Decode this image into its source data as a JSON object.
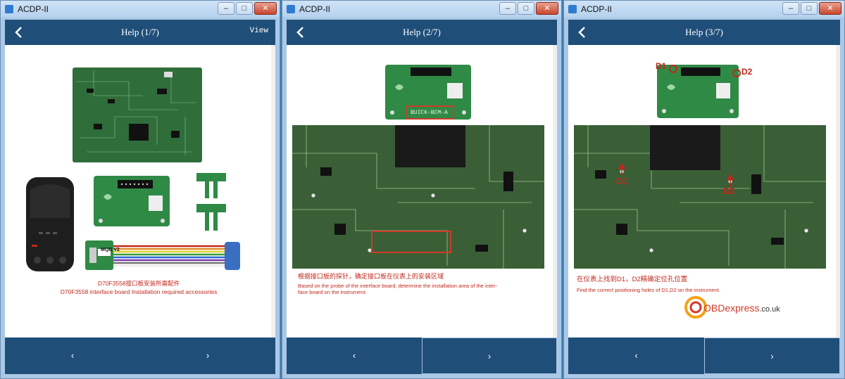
{
  "window_title": "ACDP-II",
  "window_buttons": {
    "minimize": "–",
    "maximize": "□",
    "close": "✕"
  },
  "colors": {
    "nav": "#1f4e79",
    "accent_red": "#c0281c",
    "pcb_green": "#2f6e3a"
  },
  "windows": [
    {
      "page_title": "Help (1/7)",
      "view_label": "View",
      "captions": {
        "cn": "D70F3558接口板安装所需配件",
        "en": "D70F3558 interface board Installation required accessories"
      },
      "labels": {
        "adapter": "MQB V2"
      },
      "footer": {
        "prev": "‹",
        "next": "›"
      }
    },
    {
      "page_title": "Help (2/7)",
      "board_label": "BUICK-BCM-A",
      "captions": {
        "cn": "根据接口板的探针，确定接口板在仪表上的安装区域",
        "en1": "Based on the probe of the interface board, determine the installation area of the inter-",
        "en2": "face board on the instrument."
      },
      "footer": {
        "prev": "‹",
        "next": "›"
      }
    },
    {
      "page_title": "Help (3/7)",
      "markers": {
        "d1": "D1",
        "d2": "D2"
      },
      "captions": {
        "cn": "在仪表上找到D1，D2精确定位孔位置",
        "en": "Find the correct positioning holes of D1,D2 on the instrument."
      },
      "watermark": {
        "brand": "OBDexpress",
        "suffix": ".co.uk"
      },
      "footer": {
        "prev": "‹",
        "next": "›"
      }
    }
  ]
}
